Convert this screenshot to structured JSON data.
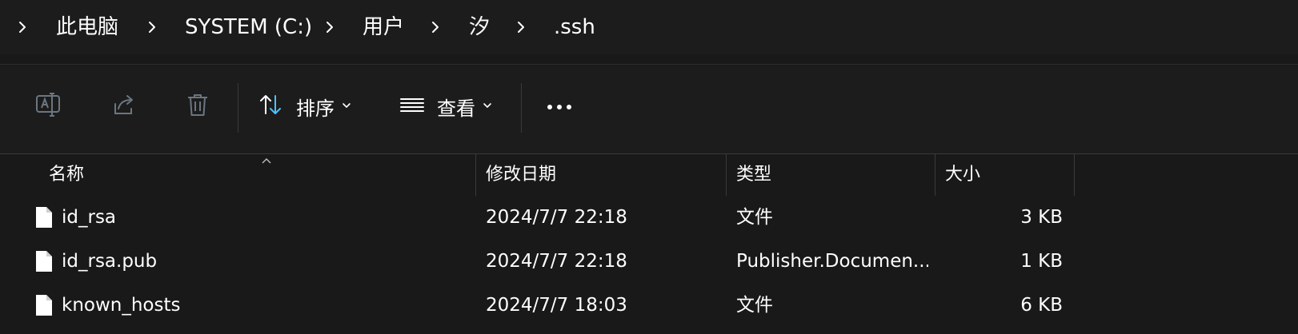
{
  "breadcrumb": {
    "items": [
      "此电脑",
      "SYSTEM (C:)",
      "用户",
      "汐",
      ".ssh"
    ]
  },
  "commandbar": {
    "rename_icon": "rename-icon",
    "share_icon": "share-icon",
    "delete_icon": "trash-icon",
    "sort_label": "排序",
    "view_label": "查看",
    "more_icon": "more-icon"
  },
  "columns": {
    "name": "名称",
    "modified": "修改日期",
    "type": "类型",
    "size": "大小"
  },
  "files": [
    {
      "name": "id_rsa",
      "modified": "2024/7/7 22:18",
      "type": "文件",
      "size": "3 KB"
    },
    {
      "name": "id_rsa.pub",
      "modified": "2024/7/7 22:18",
      "type": "Publisher.Documen...",
      "size": "1 KB"
    },
    {
      "name": "known_hosts",
      "modified": "2024/7/7 18:03",
      "type": "文件",
      "size": "6 KB"
    }
  ],
  "colors": {
    "background": "#191919",
    "accent": "#4cc2ff",
    "disabled_icon": "#6b7680"
  }
}
